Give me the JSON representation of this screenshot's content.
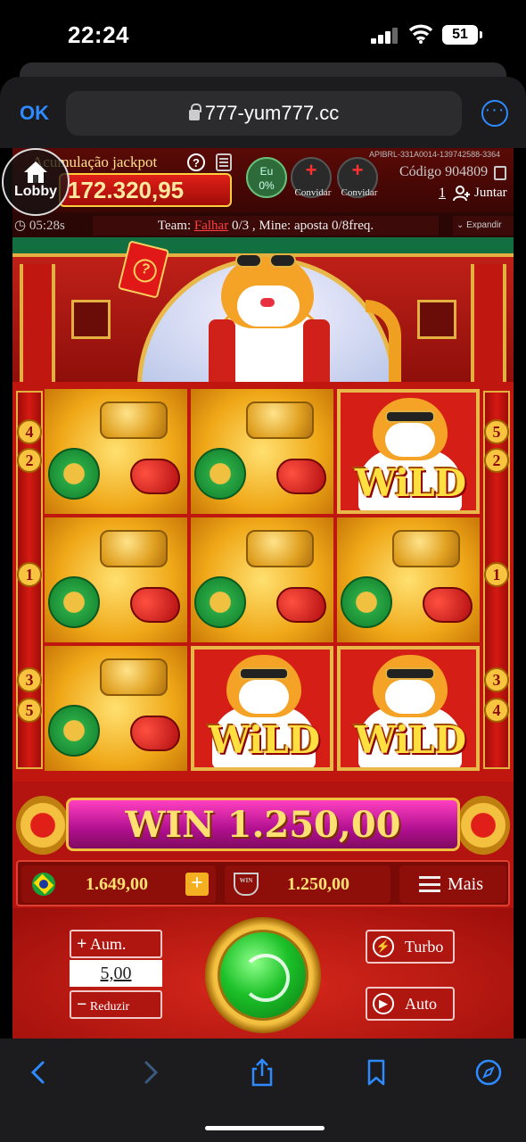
{
  "status_bar": {
    "time": "22:24",
    "battery": "51"
  },
  "browser": {
    "ok_label": "OK",
    "url": "777-yum777.cc"
  },
  "game": {
    "lobby_label": "Lobby",
    "jackpot_label": "Acumulação jackpot",
    "jackpot_value": "172.320,95",
    "eu_label": "Eu",
    "eu_percent": "0%",
    "invite_label_1": "Convidar",
    "invite_label_2": "Convidar",
    "api_id": "APIBRL-331A0014-139742588-3364",
    "code_label": "Código 904809",
    "member_count": "1",
    "join_label": "Juntar",
    "timer": "05:28s",
    "team_prefix": "Team:",
    "team_status": "Falhar",
    "team_suffix": "0/3 , Mine: aposta 0/8freq.",
    "expand_label": "Expandir",
    "wild_label": "WiLD",
    "line_numbers_left": [
      "4",
      "2",
      "1",
      "3",
      "5"
    ],
    "line_numbers_right": [
      "5",
      "2",
      "1",
      "3",
      "4"
    ],
    "win_text": "WIN 1.250,00",
    "balance": "1.649,00",
    "last_win": "1.250,00",
    "win_icon_text": "WIN",
    "more_label": "Mais",
    "increase_label": "Aum.",
    "bet_value": "5,00",
    "decrease_label": "Reduzir",
    "turbo_label": "Turbo",
    "auto_label": "Auto"
  },
  "reels": {
    "grid": [
      [
        "jade-ingot",
        "jade-ingot",
        "wild"
      ],
      [
        "jade-ingot",
        "jade-ingot",
        "jade-ingot"
      ],
      [
        "jade-ingot",
        "wild",
        "wild"
      ]
    ]
  },
  "colors": {
    "accent_blue": "#2e8bff",
    "game_red": "#b4140f",
    "gold": "#f4c040",
    "spin_green": "#1cc028",
    "win_magenta": "#b01090"
  }
}
